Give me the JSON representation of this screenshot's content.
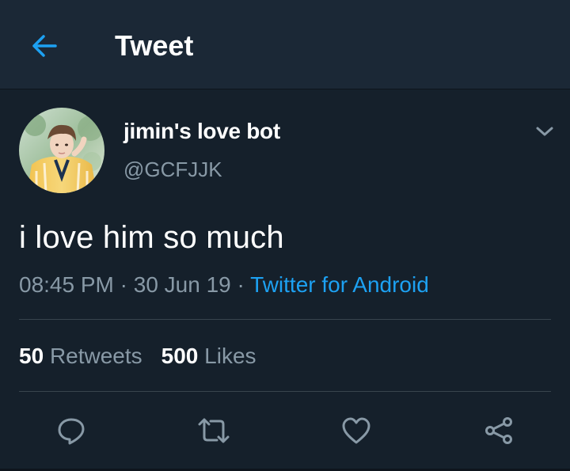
{
  "header": {
    "title": "Tweet",
    "back_icon": "arrow-left-icon"
  },
  "tweet": {
    "display_name": "jimin's love bot",
    "handle": "@GCFJJK",
    "text": "i love him so much",
    "time": "08:45 PM",
    "date": "30 Jun 19",
    "separator": " · ",
    "source": "Twitter for Android",
    "caret_icon": "chevron-down-icon"
  },
  "stats": {
    "retweets_count": "50",
    "retweets_label": "Retweets",
    "likes_count": "500",
    "likes_label": "Likes"
  },
  "actions": {
    "reply_icon": "reply-icon",
    "retweet_icon": "retweet-icon",
    "like_icon": "heart-icon",
    "share_icon": "share-icon"
  },
  "colors": {
    "background": "#15202b",
    "header_background": "#1b2836",
    "accent": "#1da1f2",
    "secondary_text": "#8899a6",
    "divider": "#38444d"
  }
}
